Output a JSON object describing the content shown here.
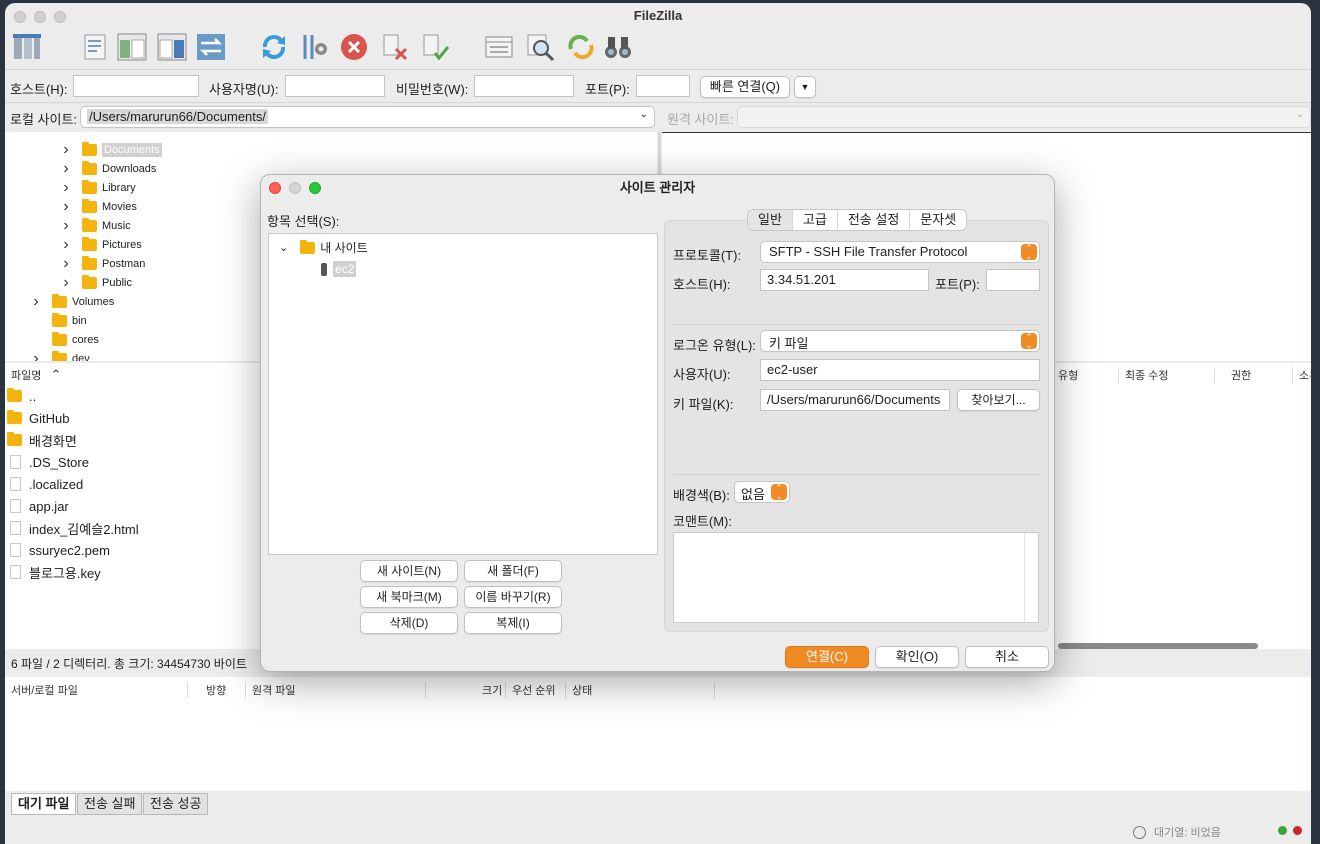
{
  "app": {
    "title": "FileZilla"
  },
  "quickconnect": {
    "host_label": "호스트(H):",
    "user_label": "사용자명(U):",
    "pass_label": "비밀번호(W):",
    "port_label": "포트(P):",
    "connect_button": "빠른 연결(Q)"
  },
  "local": {
    "site_label": "로컬 사이트:",
    "path": "/Users/marurun66/Documents/",
    "tree": [
      {
        "name": "Documents",
        "depth": 2,
        "selected": true
      },
      {
        "name": "Downloads",
        "depth": 2
      },
      {
        "name": "Library",
        "depth": 2
      },
      {
        "name": "Movies",
        "depth": 2
      },
      {
        "name": "Music",
        "depth": 2
      },
      {
        "name": "Pictures",
        "depth": 2
      },
      {
        "name": "Postman",
        "depth": 2
      },
      {
        "name": "Public",
        "depth": 2
      },
      {
        "name": "Volumes",
        "depth": 1,
        "chevron": true
      },
      {
        "name": "bin",
        "depth": 1
      },
      {
        "name": "cores",
        "depth": 1
      },
      {
        "name": "dev",
        "depth": 1,
        "chevron": true
      }
    ],
    "filename_header": "파일명",
    "files": [
      {
        "name": "..",
        "type": "folder"
      },
      {
        "name": "GitHub",
        "type": "folder"
      },
      {
        "name": "배경화면",
        "type": "folder"
      },
      {
        "name": ".DS_Store",
        "type": "file"
      },
      {
        "name": ".localized",
        "type": "file"
      },
      {
        "name": "app.jar",
        "type": "file"
      },
      {
        "name": "index_김예슬2.html",
        "type": "file"
      },
      {
        "name": "ssuryec2.pem",
        "type": "file"
      },
      {
        "name": "블로그용.key",
        "type": "file"
      }
    ],
    "status": "6 파일 / 2 디렉터리. 총 크기: 34454730 바이트"
  },
  "remote": {
    "site_label": "원격 사이트:",
    "headers": [
      "유형",
      "최종 수정",
      "권한",
      "소유"
    ]
  },
  "queue": {
    "headers": [
      "서버/로컬 파일",
      "방향",
      "원격 파일",
      "크기",
      "우선 순위",
      "상태"
    ],
    "tabs": [
      "대기 파일",
      "전송 실패",
      "전송 성공"
    ],
    "status": "대기열: 비었음"
  },
  "dialog": {
    "title": "사이트 관리자",
    "select_label": "항목 선택(S):",
    "root": "내 사이트",
    "site": "ec2",
    "tabs": [
      "일반",
      "고급",
      "전송 설정",
      "문자셋"
    ],
    "protocol_label": "프로토콜(T):",
    "protocol_value": "SFTP - SSH File Transfer Protocol",
    "host_label": "호스트(H):",
    "host_value": "3.34.51.201",
    "port_label": "포트(P):",
    "logon_label": "로그온 유형(L):",
    "logon_value": "키 파일",
    "user_label": "사용자(U):",
    "user_value": "ec2-user",
    "keyfile_label": "키 파일(K):",
    "keyfile_value": "/Users/marurun66/Documents",
    "browse_button": "찾아보기...",
    "bgcolor_label": "배경색(B):",
    "bgcolor_value": "없음",
    "comment_label": "코맨트(M):",
    "buttons": {
      "new_site": "새 사이트(N)",
      "new_folder": "새 폴더(F)",
      "new_bookmark": "새 북마크(M)",
      "rename": "이름 바꾸기(R)",
      "delete": "삭제(D)",
      "duplicate": "복제(I)"
    },
    "connect": "연결(C)",
    "ok": "확인(O)",
    "cancel": "취소"
  },
  "colors": {
    "accent": "#f08a24",
    "selection": "#d0d0d0"
  }
}
